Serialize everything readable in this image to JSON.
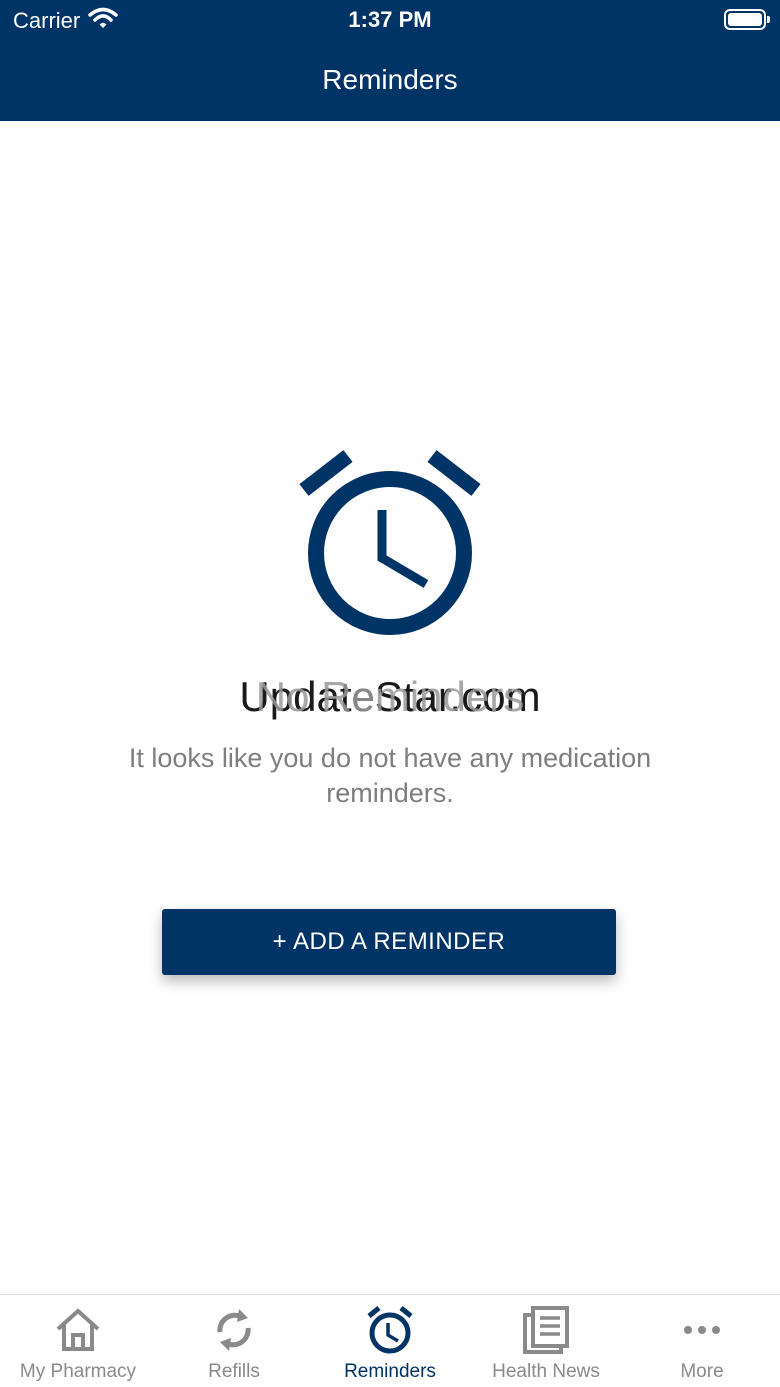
{
  "status_bar": {
    "carrier": "Carrier",
    "time": "1:37 PM"
  },
  "header": {
    "title": "Reminders"
  },
  "empty_state": {
    "icon": "alarm-clock-icon",
    "watermark": "UpdateStar.com",
    "title": "No Reminders",
    "message": "It looks like you do not have any medication reminders."
  },
  "add_button": {
    "label": "+ ADD A REMINDER"
  },
  "tabbar": {
    "tabs": [
      {
        "label": "My Pharmacy",
        "icon": "home-icon",
        "active": false
      },
      {
        "label": "Refills",
        "icon": "refresh-icon",
        "active": false
      },
      {
        "label": "Reminders",
        "icon": "alarm-clock-icon",
        "active": true
      },
      {
        "label": "Health News",
        "icon": "newspaper-icon",
        "active": false
      },
      {
        "label": "More",
        "icon": "more-dots-icon",
        "active": false
      }
    ]
  },
  "colors": {
    "primary": "#003466",
    "inactive": "#8a8a8a",
    "message_text": "#7e7e7e"
  }
}
